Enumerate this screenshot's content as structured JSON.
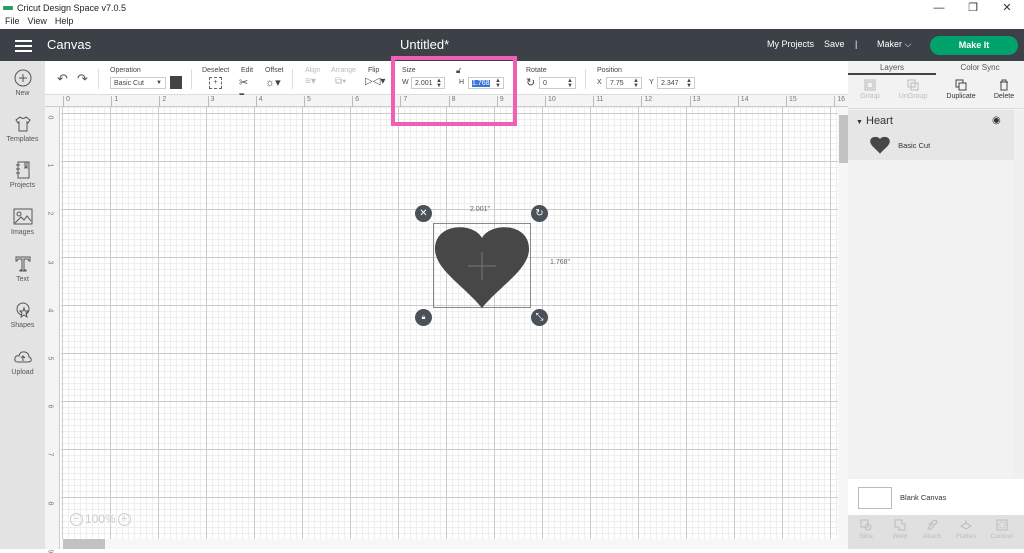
{
  "window": {
    "title": "Cricut Design Space  v7.0.5",
    "controls": [
      "minimize",
      "maximize",
      "close"
    ]
  },
  "menu": [
    "File",
    "View",
    "Help"
  ],
  "header": {
    "section": "Canvas",
    "doc_title": "Untitled*",
    "my_projects": "My Projects",
    "save": "Save",
    "divider": "|",
    "machine": "Maker",
    "make_it": "Make It",
    "make_it_color": "#00a36c"
  },
  "sidebar": {
    "items": [
      {
        "label": "New",
        "icon": "plus-circle-icon"
      },
      {
        "label": "Templates",
        "icon": "tshirt-icon"
      },
      {
        "label": "Projects",
        "icon": "notebook-icon"
      },
      {
        "label": "Images",
        "icon": "image-icon"
      },
      {
        "label": "Text",
        "icon": "text-icon"
      },
      {
        "label": "Shapes",
        "icon": "shapes-icon"
      },
      {
        "label": "Upload",
        "icon": "cloud-upload-icon"
      }
    ]
  },
  "toolbar": {
    "operation_label": "Operation",
    "operation_value": "Basic Cut",
    "swatch_color": "#444444",
    "deselect": "Deselect",
    "edit": "Edit",
    "offset": "Offset",
    "align": "Align",
    "arrange": "Arrange",
    "flip": "Flip",
    "size_label": "Size",
    "w_label": "W",
    "w_value": "2.001",
    "h_label": "H",
    "h_value": "1.768",
    "rotate_label": "Rotate",
    "rotate_value": "0",
    "position_label": "Position",
    "x_label": "X",
    "x_value": "7.75",
    "y_label": "Y",
    "y_value": "2.347"
  },
  "ruler": {
    "top": [
      "0",
      "1",
      "2",
      "3",
      "4",
      "5",
      "6",
      "7",
      "8",
      "9",
      "10",
      "11",
      "12",
      "13",
      "14",
      "15",
      "16"
    ],
    "left": [
      "0",
      "1",
      "2",
      "3",
      "4",
      "5",
      "6",
      "7",
      "8",
      "9"
    ]
  },
  "canvas": {
    "zoom": "100%",
    "selection": {
      "width_label": "2.001\"",
      "height_label": "1.768\""
    },
    "highlight_color": "#ef5fb3"
  },
  "layers_panel": {
    "tabs": [
      "Layers",
      "Color Sync"
    ],
    "tools": [
      {
        "label": "Group",
        "enabled": false
      },
      {
        "label": "UnGroup",
        "enabled": false
      },
      {
        "label": "Duplicate",
        "enabled": true
      },
      {
        "label": "Delete",
        "enabled": true
      }
    ],
    "layer": {
      "name": "Heart",
      "item": "Basic Cut"
    },
    "blank_canvas": "Blank Canvas",
    "bottom_tools": [
      "Slice",
      "Weld",
      "Attach",
      "Flatten",
      "Contour"
    ]
  }
}
